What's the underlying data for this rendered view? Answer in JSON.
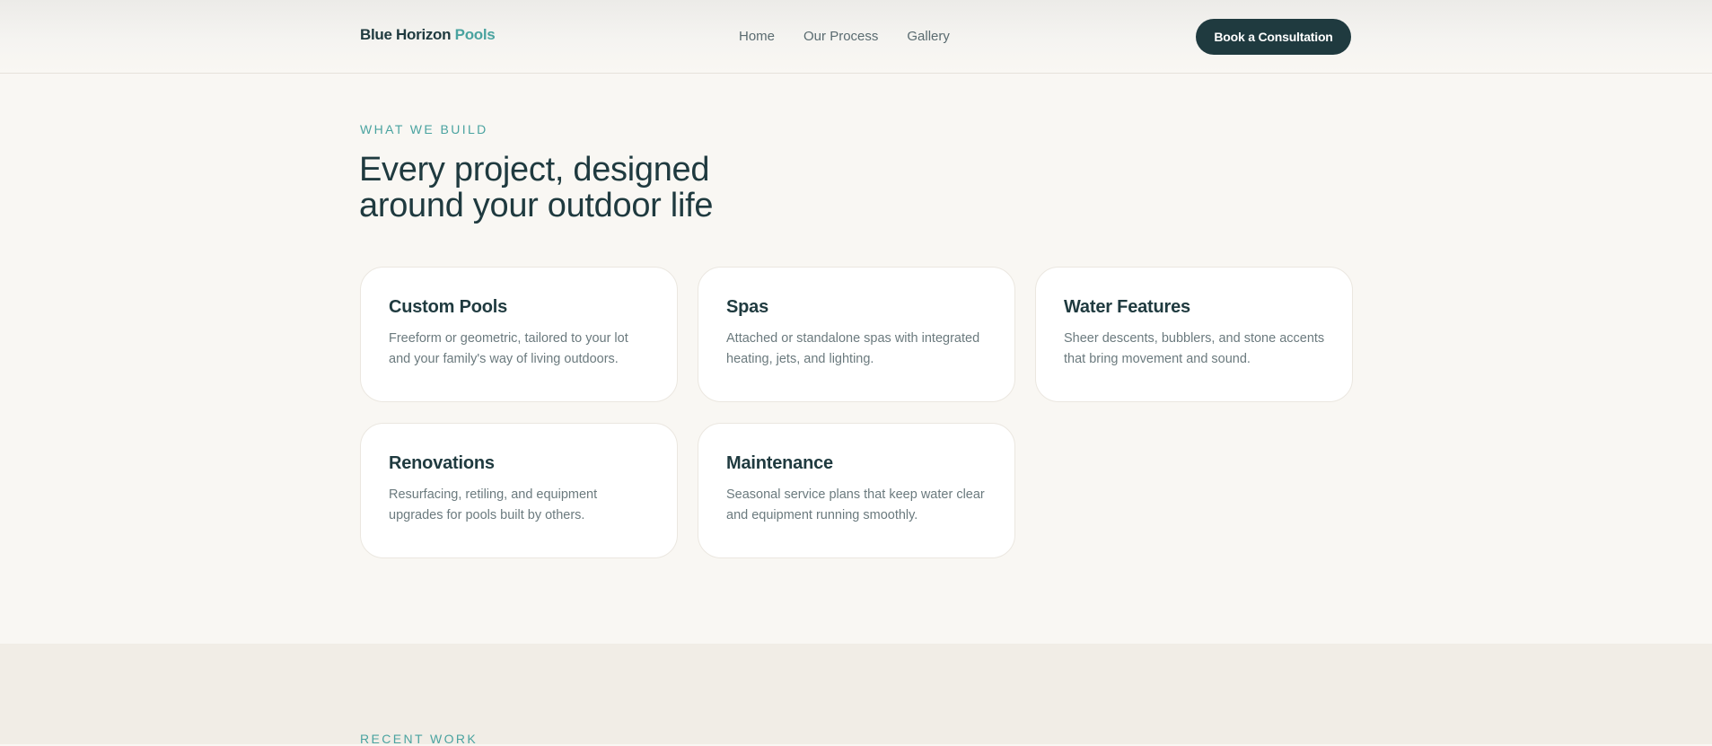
{
  "header": {
    "brand_main": "Blue Horizon",
    "brand_accent": "Pools",
    "nav": [
      {
        "label": "Home"
      },
      {
        "label": "Our Process"
      },
      {
        "label": "Gallery"
      }
    ],
    "cta_label": "Book a Consultation"
  },
  "services": {
    "eyebrow": "WHAT WE BUILD",
    "title": "Every project, designed around your outdoor life",
    "cards": [
      {
        "title": "Custom Pools",
        "description": "Freeform or geometric, tailored to your lot and your family's way of living outdoors."
      },
      {
        "title": "Spas",
        "description": "Attached or standalone spas with integrated heating, jets, and lighting."
      },
      {
        "title": "Water Features",
        "description": "Sheer descents, bubblers, and stone accents that bring movement and sound."
      },
      {
        "title": "Renovations",
        "description": "Resurfacing, retiling, and equipment upgrades for pools built by others."
      },
      {
        "title": "Maintenance",
        "description": "Seasonal service plans that keep water clear and equipment running smoothly."
      }
    ]
  },
  "recent": {
    "eyebrow": "RECENT WORK"
  },
  "colors": {
    "accent": "#4aa3a0",
    "dark": "#1f3a3f",
    "background": "#f9f7f3",
    "band": "#f1ede6"
  }
}
